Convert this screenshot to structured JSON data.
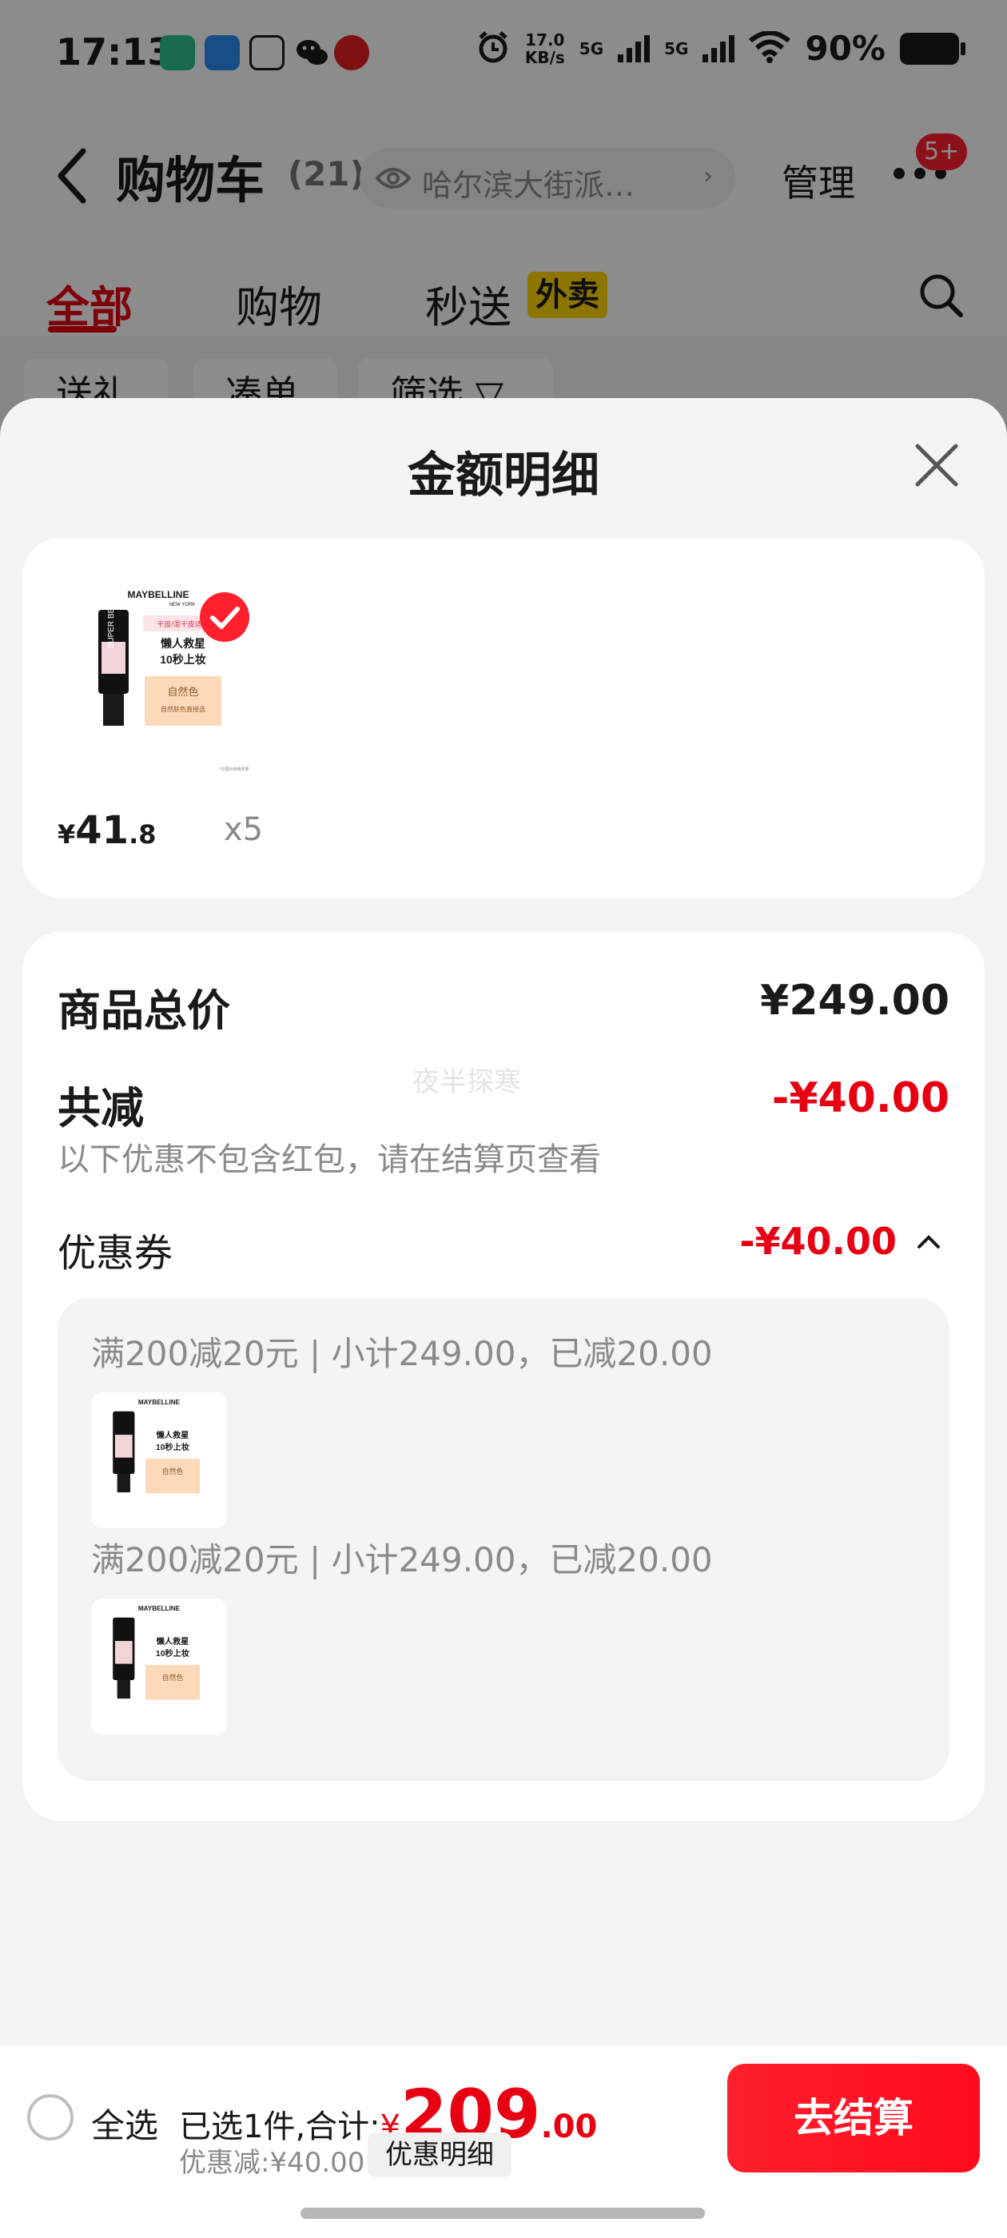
{
  "status_bar": {
    "time": "17:13",
    "net_speed_value": "17.0",
    "net_speed_unit": "KB/s",
    "sim1": "5G",
    "sim2": "5G",
    "battery": "90%",
    "app_icons": [
      "shield-app-icon",
      "phone-app-icon",
      "tab-app-icon",
      "wechat-icon",
      "zhi-app-icon"
    ]
  },
  "header": {
    "title": "购物车",
    "count": "(21)",
    "address": "哈尔滨大街派…",
    "manage": "管理",
    "badge": "5+"
  },
  "tabs": [
    {
      "label": "全部",
      "active": true
    },
    {
      "label": "购物",
      "active": false
    },
    {
      "label": "秒送",
      "active": false
    }
  ],
  "waimai_tag": "外卖",
  "filter_chips": [
    "送礼",
    "凑单",
    "筛选 ▽"
  ],
  "sheet": {
    "title": "金额明细",
    "product": {
      "brand": "MAYBELLINE",
      "brand_sub": "NEW YORK",
      "tube_label": "SUPER BB",
      "promo_tag": "干皮/混干皮适用",
      "promo_line1": "懒人救星",
      "promo_line2": "10秒上妆",
      "shade": "自然色",
      "shade_sub": "自然肤色直接选",
      "fine_print": "*仅展示使用效果",
      "currency": "¥",
      "price_int": "41",
      "price_dec": ".8",
      "quantity": "x5"
    },
    "summary": {
      "total_label": "商品总价",
      "total_value": "¥249.00",
      "reduce_label": "共减",
      "reduce_value": "-¥40.00",
      "note": "以下优惠不包含红包，请在结算页查看",
      "watermark": "夜半探寒",
      "coupon_label": "优惠券",
      "coupon_value": "-¥40.00",
      "coupons": [
        {
          "text": "满200减20元 | 小计249.00，已减20.00"
        },
        {
          "text": "满200减20元 | 小计249.00，已减20.00"
        }
      ]
    }
  },
  "bottom_bar": {
    "select_all": "全选",
    "selected_prefix": "已选1件,合计:",
    "currency": "¥",
    "total_int": "209",
    "total_dec": ".00",
    "discount": "优惠减:¥40.00",
    "detail_button": "优惠明细",
    "checkout_button": "去结算"
  },
  "colors": {
    "accent_red": "#e60012",
    "button_red": "#ff1f2d",
    "waimai_yellow": "#ffd600",
    "sheet_bg": "#f4f4f5"
  }
}
